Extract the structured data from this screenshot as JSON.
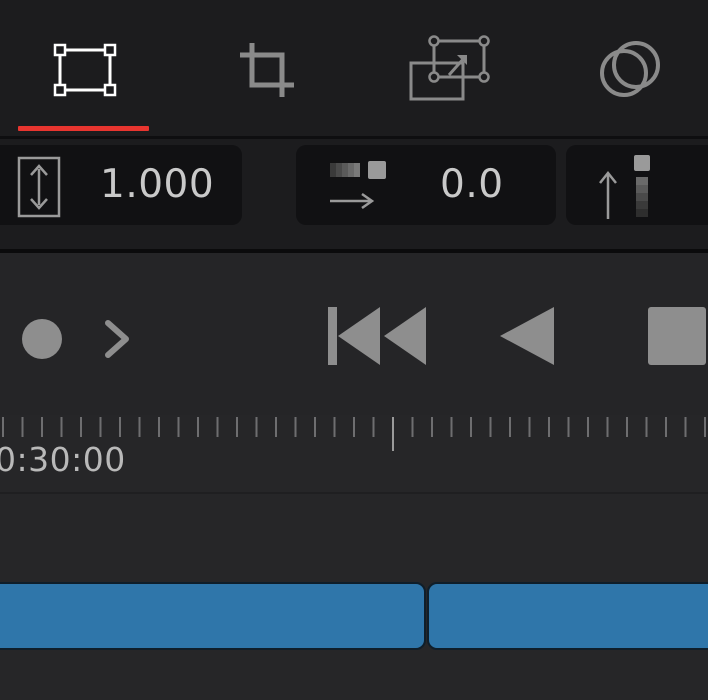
{
  "tabs": [
    {
      "id": "transform",
      "icon": "transform-icon",
      "active": true
    },
    {
      "id": "crop",
      "icon": "crop-icon",
      "active": false
    },
    {
      "id": "dynamic-zoom",
      "icon": "dynamic-zoom-icon",
      "active": false
    },
    {
      "id": "composite",
      "icon": "composite-icon",
      "active": false
    }
  ],
  "params": {
    "zoom_value": "1.000",
    "position_value": "0.0"
  },
  "transport": {
    "record_icon": "record-dot-icon",
    "expand_icon": "chevron-right-icon",
    "skip_start_icon": "skip-to-start-icon",
    "play_reverse_icon": "play-reverse-icon",
    "stop_icon": "stop-icon"
  },
  "timeline": {
    "timecode": "0:30:00"
  },
  "colors": {
    "accent": "#e8352f",
    "clip": "#2f76aa",
    "background": "#1b1b1d"
  }
}
